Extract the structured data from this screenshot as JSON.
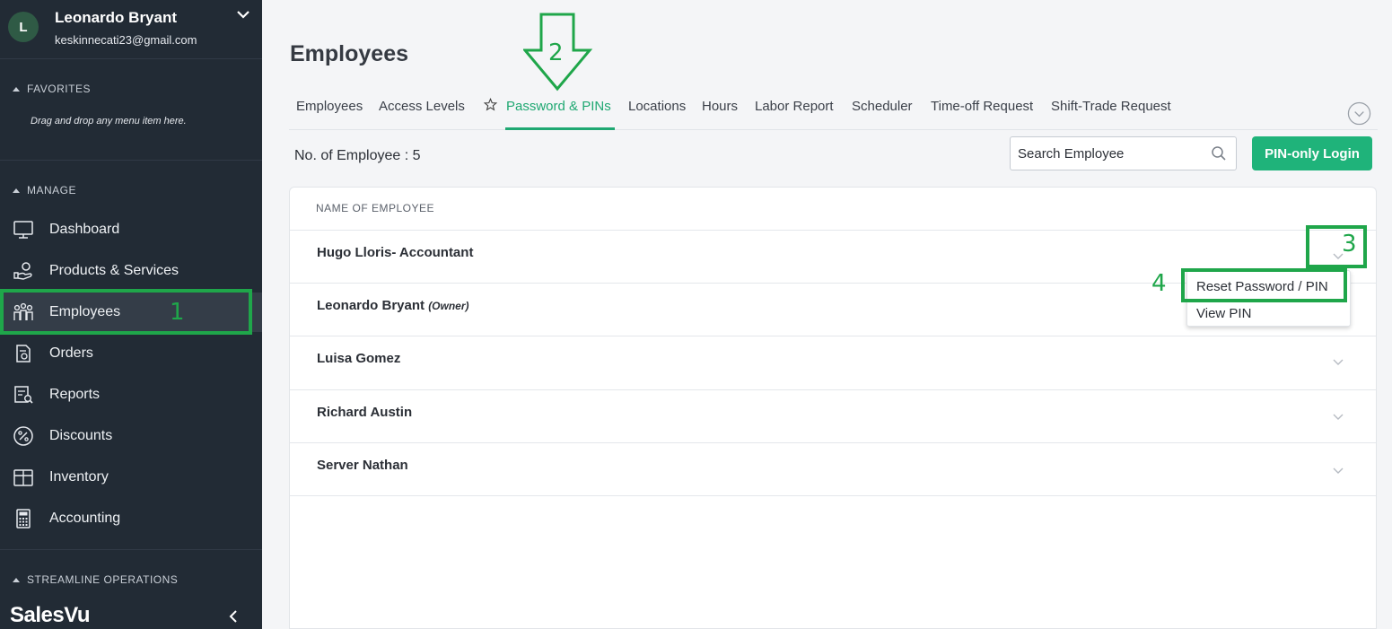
{
  "user": {
    "initial": "L",
    "name": "Leonardo Bryant",
    "email": "keskinnecati23@gmail.com"
  },
  "sidebar": {
    "favorites_label": "FAVORITES",
    "favorites_hint": "Drag and drop any menu item here.",
    "manage_label": "MANAGE",
    "items": [
      {
        "label": "Dashboard",
        "icon": "monitor-icon"
      },
      {
        "label": "Products & Services",
        "icon": "products-icon"
      },
      {
        "label": "Employees",
        "icon": "employees-icon",
        "active": true
      },
      {
        "label": "Orders",
        "icon": "orders-icon"
      },
      {
        "label": "Reports",
        "icon": "reports-icon"
      },
      {
        "label": "Discounts",
        "icon": "percent-icon"
      },
      {
        "label": "Inventory",
        "icon": "inventory-icon"
      },
      {
        "label": "Accounting",
        "icon": "calculator-icon"
      }
    ],
    "streamline_label": "STREAMLINE OPERATIONS",
    "brand": "SalesVu"
  },
  "page": {
    "title": "Employees",
    "tabs": [
      {
        "label": "Employees"
      },
      {
        "label": "Access Levels"
      },
      {
        "label": "Password & PINs",
        "active": true
      },
      {
        "label": "Locations"
      },
      {
        "label": "Hours"
      },
      {
        "label": "Labor Report"
      },
      {
        "label": "Scheduler"
      },
      {
        "label": "Time-off Request"
      },
      {
        "label": "Shift-Trade Request"
      }
    ],
    "count_text": "No. of Employee : 5",
    "search_placeholder": "Search Employee",
    "pin_button": "PIN-only Login"
  },
  "table": {
    "column_header": "NAME OF EMPLOYEE",
    "rows": [
      {
        "name": "Hugo Lloris- Accountant",
        "tag": ""
      },
      {
        "name": "Leonardo Bryant",
        "tag": "(Owner)"
      },
      {
        "name": "Luisa Gomez",
        "tag": ""
      },
      {
        "name": "Richard Austin",
        "tag": ""
      },
      {
        "name": "Server Nathan",
        "tag": ""
      }
    ]
  },
  "dropdown": {
    "items": [
      "Reset Password / PIN",
      "View PIN"
    ]
  },
  "annotations": [
    "1",
    "2",
    "3",
    "4"
  ],
  "colors": {
    "sidebar_bg": "#222b35",
    "accent_green": "#1fb37a",
    "annotation_green": "#1fa64a"
  }
}
